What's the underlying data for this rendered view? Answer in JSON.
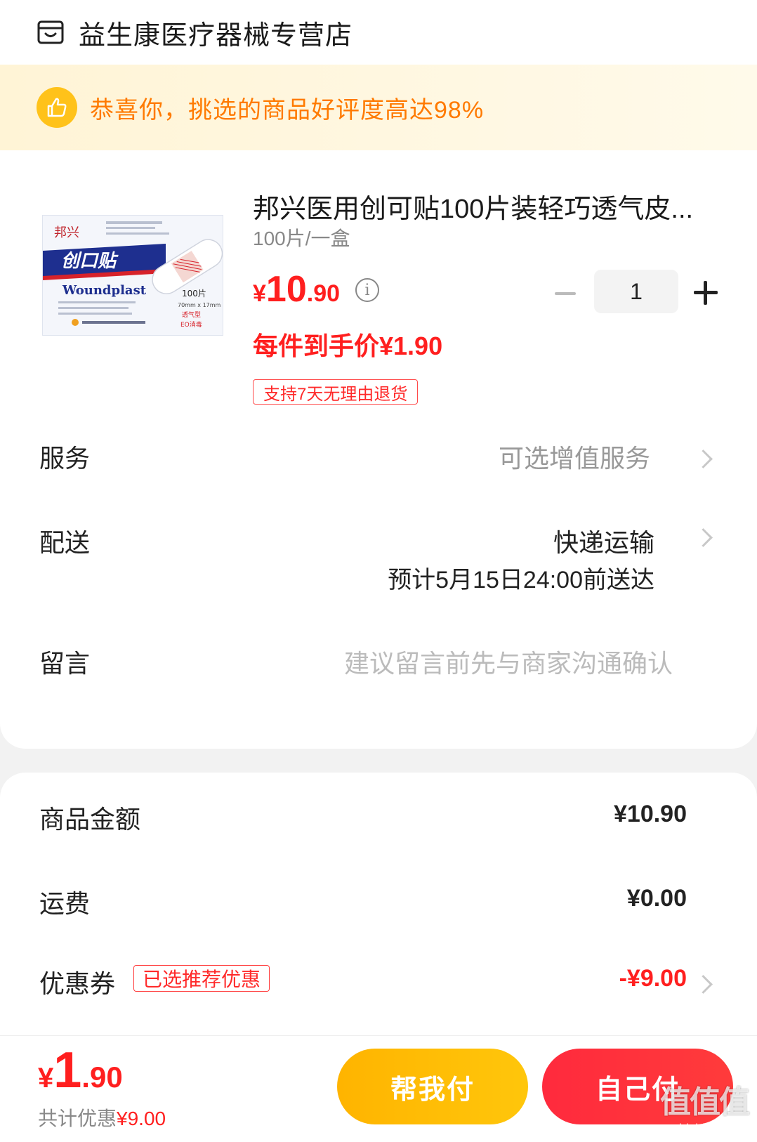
{
  "store": {
    "name": "益生康医疗器械专营店",
    "icon": "store-icon"
  },
  "banner": {
    "text": "恭喜你，挑选的商品好评度高达98%",
    "icon": "thumbs-up-icon",
    "color": "#ff7a00"
  },
  "product": {
    "title": "邦兴医用创可贴100片装轻巧透气皮...",
    "spec": "100片/一盒",
    "price_symbol": "¥",
    "price_int": "10",
    "price_dec": ".90",
    "quantity": "1",
    "unit_price": "每件到手价¥1.90",
    "return_policy": "支持7天无理由退货",
    "image": {
      "brand": "邦兴",
      "name_cn": "创口贴",
      "name_en": "Woundplast",
      "count": "100片",
      "size": "70mm x 17mm",
      "type": "透气型",
      "sterile": "EO消毒"
    }
  },
  "service": {
    "label": "服务",
    "value": "可选增值服务"
  },
  "delivery": {
    "label": "配送",
    "method": "快递运输",
    "eta": "预计5月15日24:00前送达"
  },
  "message": {
    "label": "留言",
    "placeholder": "建议留言前先与商家沟通确认"
  },
  "summary": {
    "goods_label": "商品金额",
    "goods_value": "¥10.90",
    "shipping_label": "运费",
    "shipping_value": "¥0.00",
    "coupon_label": "优惠券",
    "coupon_badge": "已选推荐优惠",
    "coupon_value": "-¥9.00"
  },
  "footer": {
    "total_symbol": "¥",
    "total_int": "1",
    "total_dec": ".90",
    "discount_prefix": "共计优惠",
    "discount_value": "¥9.00",
    "help_pay": "帮我付",
    "self_pay": "自己付",
    "watermark_big": "值值值",
    "watermark_small": "zhizhizhi.com"
  },
  "colors": {
    "price_red": "#ff1f1f",
    "help_yellow": "#ffb400",
    "pay_red": "#ff2a3d"
  }
}
